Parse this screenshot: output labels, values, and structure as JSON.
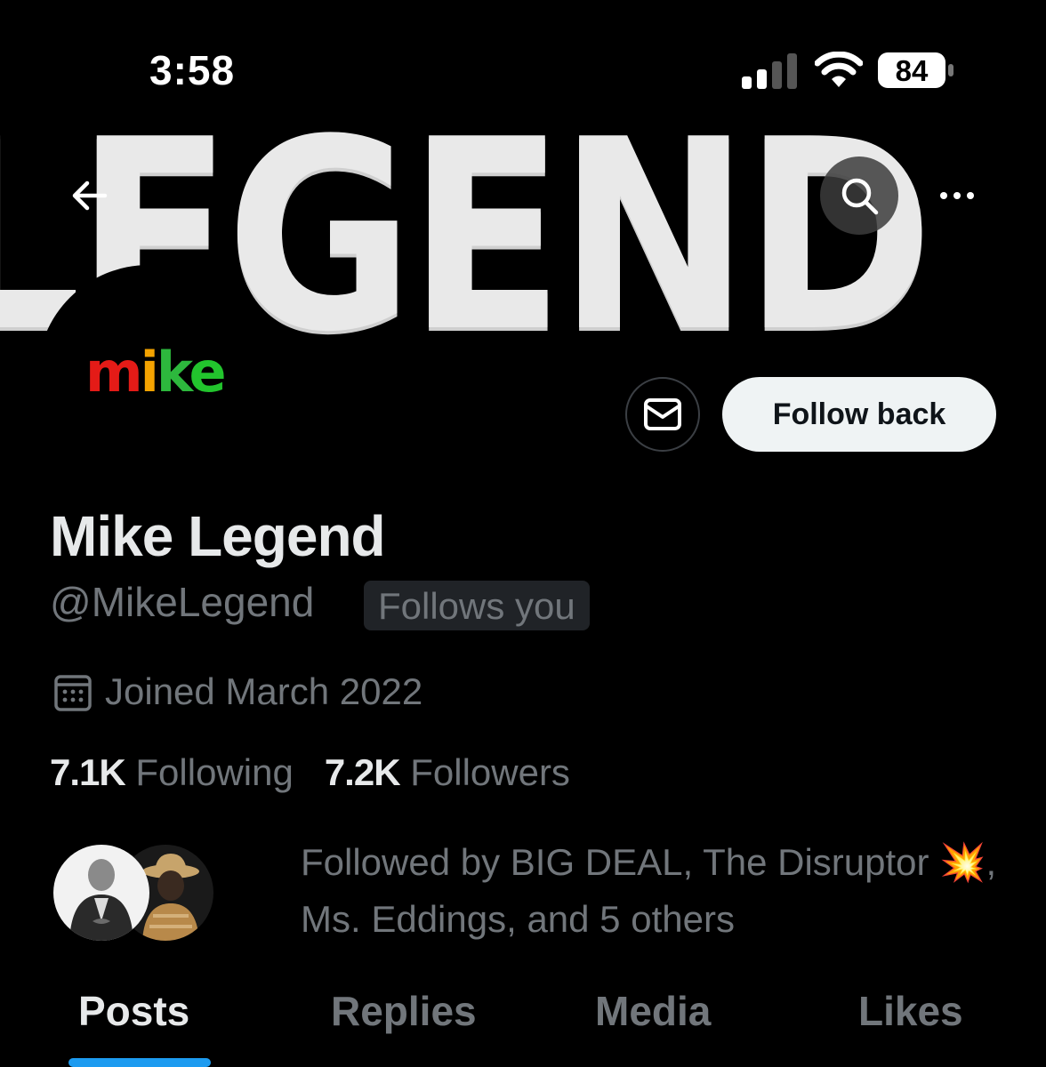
{
  "status_bar": {
    "time": "3:58",
    "battery": "84",
    "signal_icon": "cellular-signal-icon",
    "wifi_icon": "wifi-icon"
  },
  "banner": {
    "text": "LEGEND"
  },
  "header": {
    "back_icon": "back-arrow-icon",
    "search_icon": "search-icon",
    "more_icon": "more-options-icon"
  },
  "avatar": {
    "letters": [
      "m",
      "i",
      "k",
      "e"
    ],
    "letter_colors": [
      "#e41b17",
      "#f4a300",
      "#2db83d",
      "#22c42d"
    ]
  },
  "actions": {
    "message_icon": "envelope-icon",
    "follow_label": "Follow back"
  },
  "profile": {
    "name": "Mike Legend",
    "handle": "@MikeLegend",
    "follows_you": "Follows you",
    "joined": "Joined March 2022",
    "following_count": "7.1K",
    "following_label": "Following",
    "followers_count": "7.2K",
    "followers_label": "Followers"
  },
  "followed_by": {
    "text": "Followed by BIG DEAL, The Disruptor",
    "emoji": "💥",
    "text2": ", Ms. Eddings, and 5 others"
  },
  "tabs": [
    {
      "label": "Posts",
      "active": true
    },
    {
      "label": "Replies",
      "active": false
    },
    {
      "label": "Media",
      "active": false
    },
    {
      "label": "Likes",
      "active": false
    }
  ],
  "colors": {
    "accent": "#1d9bf0",
    "background": "#000000",
    "muted_text": "#71767b",
    "primary_text": "#e7e9ea"
  }
}
